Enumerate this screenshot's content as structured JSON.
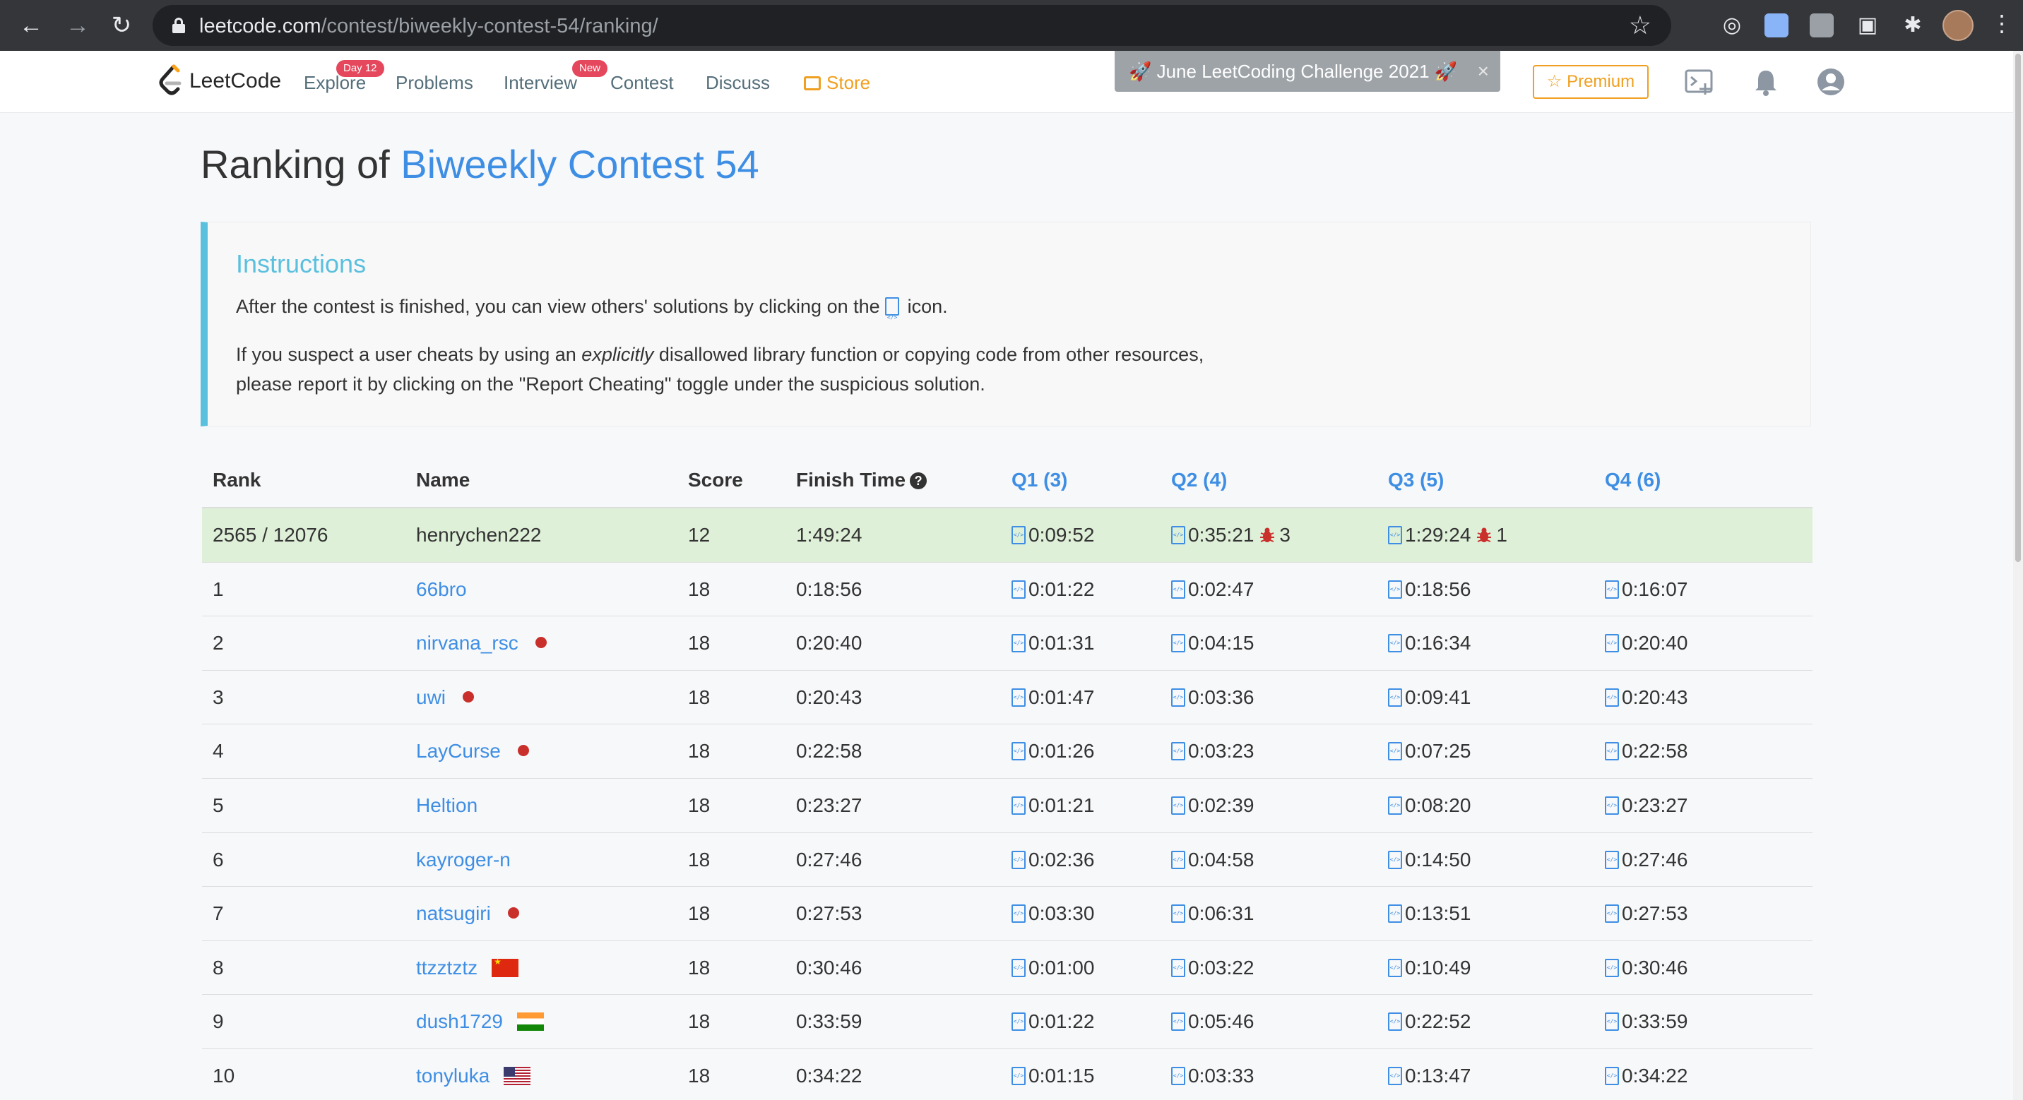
{
  "browser": {
    "url_host": "leetcode.com",
    "url_path": "/contest/biweekly-contest-54/ranking/"
  },
  "nav": {
    "logo_text": "LeetCode",
    "explore": "Explore",
    "explore_badge": "Day 12",
    "problems": "Problems",
    "interview": "Interview",
    "interview_badge": "New",
    "contest": "Contest",
    "discuss": "Discuss",
    "store": "Store",
    "challenge": "🚀 June LeetCoding Challenge 2021 🚀",
    "premium": "☆ Premium"
  },
  "page": {
    "title_prefix": "Ranking of ",
    "title_contest": "Biweekly Contest 54"
  },
  "instructions": {
    "heading": "Instructions",
    "line1_a": "After the contest is finished, you can view others' solutions by clicking on the ",
    "line1_b": " icon.",
    "line2_a": "If you suspect a user cheats by using an ",
    "line2_em": "explicitly",
    "line2_b": " disallowed library function or copying code from other resources,",
    "line3": "please report it by clicking on the \"Report Cheating\" toggle under the suspicious solution."
  },
  "table": {
    "headers": {
      "rank": "Rank",
      "name": "Name",
      "score": "Score",
      "finish": "Finish Time",
      "q1": "Q1 (3)",
      "q2": "Q2 (4)",
      "q3": "Q3 (5)",
      "q4": "Q4 (6)"
    },
    "mine": {
      "rank": "2565 / 12076",
      "name": "henrychen222",
      "score": "12",
      "finish": "1:49:24",
      "q1": "0:09:52",
      "q2": "0:35:21",
      "q2_wrong": "3",
      "q3": "1:29:24",
      "q3_wrong": "1"
    },
    "rows": [
      {
        "rank": "1",
        "name": "66bro",
        "marker": "",
        "score": "18",
        "finish": "0:18:56",
        "q1": "0:01:22",
        "q2": "0:02:47",
        "q3": "0:18:56",
        "q4": "0:16:07"
      },
      {
        "rank": "2",
        "name": "nirvana_rsc",
        "marker": "dot",
        "score": "18",
        "finish": "0:20:40",
        "q1": "0:01:31",
        "q2": "0:04:15",
        "q3": "0:16:34",
        "q4": "0:20:40"
      },
      {
        "rank": "3",
        "name": "uwi",
        "marker": "dot",
        "score": "18",
        "finish": "0:20:43",
        "q1": "0:01:47",
        "q2": "0:03:36",
        "q3": "0:09:41",
        "q4": "0:20:43"
      },
      {
        "rank": "4",
        "name": "LayCurse",
        "marker": "dot",
        "score": "18",
        "finish": "0:22:58",
        "q1": "0:01:26",
        "q2": "0:03:23",
        "q3": "0:07:25",
        "q4": "0:22:58"
      },
      {
        "rank": "5",
        "name": "Heltion",
        "marker": "",
        "score": "18",
        "finish": "0:23:27",
        "q1": "0:01:21",
        "q2": "0:02:39",
        "q3": "0:08:20",
        "q4": "0:23:27"
      },
      {
        "rank": "6",
        "name": "kayroger-n",
        "marker": "",
        "score": "18",
        "finish": "0:27:46",
        "q1": "0:02:36",
        "q2": "0:04:58",
        "q3": "0:14:50",
        "q4": "0:27:46"
      },
      {
        "rank": "7",
        "name": "natsugiri",
        "marker": "dot",
        "score": "18",
        "finish": "0:27:53",
        "q1": "0:03:30",
        "q2": "0:06:31",
        "q3": "0:13:51",
        "q4": "0:27:53"
      },
      {
        "rank": "8",
        "name": "ttzztztz",
        "marker": "flag-cn",
        "score": "18",
        "finish": "0:30:46",
        "q1": "0:01:00",
        "q2": "0:03:22",
        "q3": "0:10:49",
        "q4": "0:30:46"
      },
      {
        "rank": "9",
        "name": "dush1729",
        "marker": "flag-in",
        "score": "18",
        "finish": "0:33:59",
        "q1": "0:01:22",
        "q2": "0:05:46",
        "q3": "0:22:52",
        "q4": "0:33:59"
      },
      {
        "rank": "10",
        "name": "tonyluka",
        "marker": "flag-us",
        "score": "18",
        "finish": "0:34:22",
        "q1": "0:01:15",
        "q2": "0:03:33",
        "q3": "0:13:47",
        "q4": "0:34:22"
      }
    ]
  }
}
